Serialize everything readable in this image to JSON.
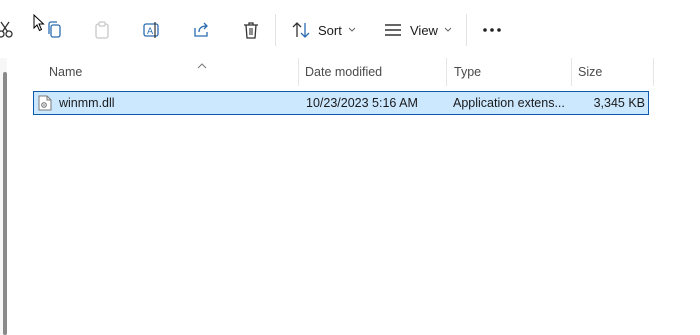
{
  "toolbar": {
    "items": [
      {
        "name": "cut",
        "icon": "scissors-icon"
      },
      {
        "name": "copy",
        "icon": "copy-icon"
      },
      {
        "name": "paste",
        "icon": "paste-icon"
      },
      {
        "name": "rename",
        "icon": "rename-icon"
      },
      {
        "name": "share",
        "icon": "share-icon"
      },
      {
        "name": "delete",
        "icon": "trash-icon"
      }
    ],
    "sort_label": "Sort",
    "view_label": "View",
    "more_icon": "more-icon"
  },
  "columns": {
    "name": "Name",
    "date_modified": "Date modified",
    "type": "Type",
    "size": "Size"
  },
  "files": [
    {
      "name": "winmm.dll",
      "date_modified": "10/23/2023 5:16 AM",
      "type": "Application extens...",
      "size": "3,345 KB",
      "selected": true,
      "icon": "dll-file-icon"
    }
  ],
  "colors": {
    "selection_bg": "#cce8ff",
    "selection_border": "#0f5aa8"
  }
}
